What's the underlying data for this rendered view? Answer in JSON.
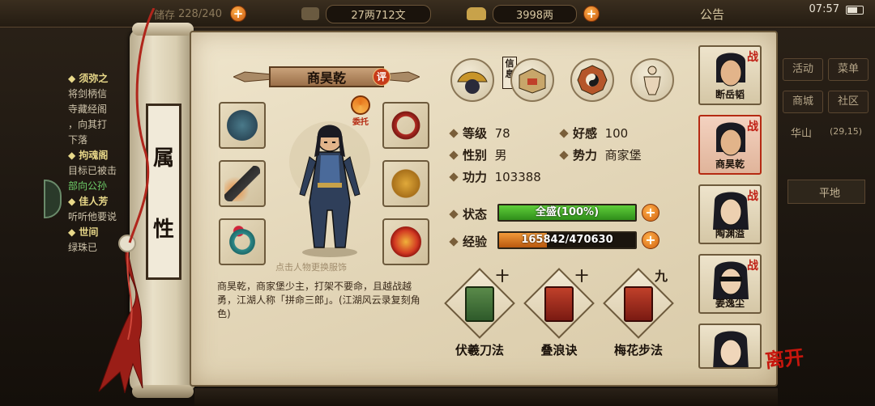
{
  "topbar": {
    "storage_label": "储存",
    "storage_value": "228/240",
    "money_value": "27两712文",
    "gold_value": "3998两",
    "notice_label": "公告",
    "clock": "07:57"
  },
  "quest_panel": {
    "items": [
      {
        "title": "◆ 须弥之",
        "lines": [
          "将剑柄信",
          "寺藏经阁",
          "，向其打",
          "下落"
        ]
      },
      {
        "title": "◆ 拘魂阁",
        "lines": [
          "目标已被击",
          "部向公孙"
        ]
      },
      {
        "title": "◆ 佳人芳",
        "lines": [
          "听听他要说"
        ]
      },
      {
        "title": "◆ 世间",
        "lines": [
          "绿珠已"
        ]
      }
    ]
  },
  "right_menu": {
    "buttons": [
      "活动",
      "菜单",
      "商城",
      "社区"
    ],
    "location": "华山",
    "coords": "(29,15)",
    "terrain": "平地"
  },
  "panel_title": [
    "属",
    "性"
  ],
  "character": {
    "name": "商昊乾",
    "rate_badge": "评",
    "entrust_label": "委托",
    "change_hint": "点击人物更换服饰",
    "bio": "商昊乾，商家堡少主，打架不要命，且越战越勇，江湖人称「拼命三郎」。(江湖风云录复刻角色)"
  },
  "tabs": {
    "info_tag": "信息"
  },
  "stats": {
    "level_label": "等级",
    "level": "78",
    "favor_label": "好感",
    "favor": "100",
    "gender_label": "性别",
    "gender": "男",
    "faction_label": "势力",
    "faction": "商家堡",
    "power_label": "功力",
    "power": "103388",
    "status_label": "状态",
    "status_text": "全盛(100%)",
    "status_fraction": 1.0,
    "exp_label": "经验",
    "exp_text": "165842/470630",
    "exp_fraction": 0.352
  },
  "skills": [
    {
      "name": "伏羲刀法",
      "level": "十"
    },
    {
      "name": "叠浪诀",
      "level": "十"
    },
    {
      "name": "梅花步法",
      "level": "九"
    }
  ],
  "roster": [
    {
      "name": "断岳韬",
      "badge": "战"
    },
    {
      "name": "商昊乾",
      "badge": "战"
    },
    {
      "name": "陶渊溢",
      "badge": "战"
    },
    {
      "name": "姜逸尘",
      "badge": "战"
    },
    {
      "name": "",
      "badge": ""
    }
  ],
  "leave_label": "离开",
  "colors": {
    "status_bar": "#3fae2a",
    "exp_bar": "#d9761c",
    "accent_red": "#c01f14"
  }
}
